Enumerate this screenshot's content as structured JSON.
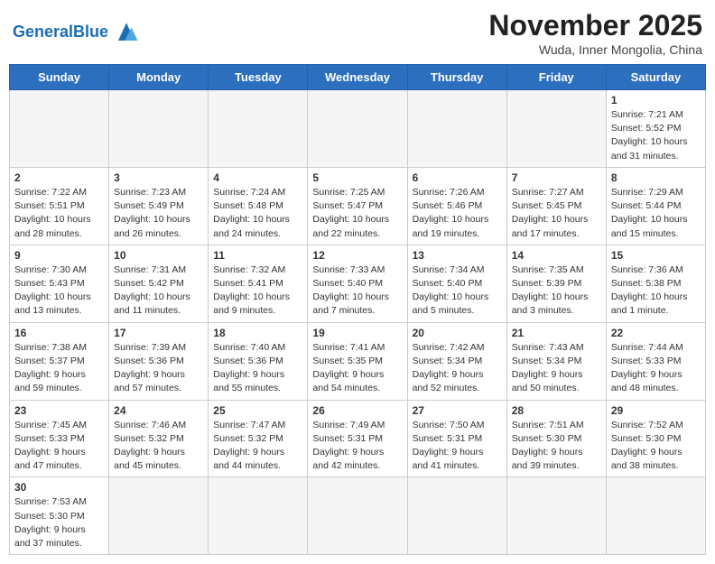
{
  "header": {
    "logo_general": "General",
    "logo_blue": "Blue",
    "month": "November 2025",
    "location": "Wuda, Inner Mongolia, China"
  },
  "weekdays": [
    "Sunday",
    "Monday",
    "Tuesday",
    "Wednesday",
    "Thursday",
    "Friday",
    "Saturday"
  ],
  "days": {
    "d1": {
      "num": "1",
      "sunrise": "Sunrise: 7:21 AM",
      "sunset": "Sunset: 5:52 PM",
      "daylight": "Daylight: 10 hours and 31 minutes."
    },
    "d2": {
      "num": "2",
      "sunrise": "Sunrise: 7:22 AM",
      "sunset": "Sunset: 5:51 PM",
      "daylight": "Daylight: 10 hours and 28 minutes."
    },
    "d3": {
      "num": "3",
      "sunrise": "Sunrise: 7:23 AM",
      "sunset": "Sunset: 5:49 PM",
      "daylight": "Daylight: 10 hours and 26 minutes."
    },
    "d4": {
      "num": "4",
      "sunrise": "Sunrise: 7:24 AM",
      "sunset": "Sunset: 5:48 PM",
      "daylight": "Daylight: 10 hours and 24 minutes."
    },
    "d5": {
      "num": "5",
      "sunrise": "Sunrise: 7:25 AM",
      "sunset": "Sunset: 5:47 PM",
      "daylight": "Daylight: 10 hours and 22 minutes."
    },
    "d6": {
      "num": "6",
      "sunrise": "Sunrise: 7:26 AM",
      "sunset": "Sunset: 5:46 PM",
      "daylight": "Daylight: 10 hours and 19 minutes."
    },
    "d7": {
      "num": "7",
      "sunrise": "Sunrise: 7:27 AM",
      "sunset": "Sunset: 5:45 PM",
      "daylight": "Daylight: 10 hours and 17 minutes."
    },
    "d8": {
      "num": "8",
      "sunrise": "Sunrise: 7:29 AM",
      "sunset": "Sunset: 5:44 PM",
      "daylight": "Daylight: 10 hours and 15 minutes."
    },
    "d9": {
      "num": "9",
      "sunrise": "Sunrise: 7:30 AM",
      "sunset": "Sunset: 5:43 PM",
      "daylight": "Daylight: 10 hours and 13 minutes."
    },
    "d10": {
      "num": "10",
      "sunrise": "Sunrise: 7:31 AM",
      "sunset": "Sunset: 5:42 PM",
      "daylight": "Daylight: 10 hours and 11 minutes."
    },
    "d11": {
      "num": "11",
      "sunrise": "Sunrise: 7:32 AM",
      "sunset": "Sunset: 5:41 PM",
      "daylight": "Daylight: 10 hours and 9 minutes."
    },
    "d12": {
      "num": "12",
      "sunrise": "Sunrise: 7:33 AM",
      "sunset": "Sunset: 5:40 PM",
      "daylight": "Daylight: 10 hours and 7 minutes."
    },
    "d13": {
      "num": "13",
      "sunrise": "Sunrise: 7:34 AM",
      "sunset": "Sunset: 5:40 PM",
      "daylight": "Daylight: 10 hours and 5 minutes."
    },
    "d14": {
      "num": "14",
      "sunrise": "Sunrise: 7:35 AM",
      "sunset": "Sunset: 5:39 PM",
      "daylight": "Daylight: 10 hours and 3 minutes."
    },
    "d15": {
      "num": "15",
      "sunrise": "Sunrise: 7:36 AM",
      "sunset": "Sunset: 5:38 PM",
      "daylight": "Daylight: 10 hours and 1 minute."
    },
    "d16": {
      "num": "16",
      "sunrise": "Sunrise: 7:38 AM",
      "sunset": "Sunset: 5:37 PM",
      "daylight": "Daylight: 9 hours and 59 minutes."
    },
    "d17": {
      "num": "17",
      "sunrise": "Sunrise: 7:39 AM",
      "sunset": "Sunset: 5:36 PM",
      "daylight": "Daylight: 9 hours and 57 minutes."
    },
    "d18": {
      "num": "18",
      "sunrise": "Sunrise: 7:40 AM",
      "sunset": "Sunset: 5:36 PM",
      "daylight": "Daylight: 9 hours and 55 minutes."
    },
    "d19": {
      "num": "19",
      "sunrise": "Sunrise: 7:41 AM",
      "sunset": "Sunset: 5:35 PM",
      "daylight": "Daylight: 9 hours and 54 minutes."
    },
    "d20": {
      "num": "20",
      "sunrise": "Sunrise: 7:42 AM",
      "sunset": "Sunset: 5:34 PM",
      "daylight": "Daylight: 9 hours and 52 minutes."
    },
    "d21": {
      "num": "21",
      "sunrise": "Sunrise: 7:43 AM",
      "sunset": "Sunset: 5:34 PM",
      "daylight": "Daylight: 9 hours and 50 minutes."
    },
    "d22": {
      "num": "22",
      "sunrise": "Sunrise: 7:44 AM",
      "sunset": "Sunset: 5:33 PM",
      "daylight": "Daylight: 9 hours and 48 minutes."
    },
    "d23": {
      "num": "23",
      "sunrise": "Sunrise: 7:45 AM",
      "sunset": "Sunset: 5:33 PM",
      "daylight": "Daylight: 9 hours and 47 minutes."
    },
    "d24": {
      "num": "24",
      "sunrise": "Sunrise: 7:46 AM",
      "sunset": "Sunset: 5:32 PM",
      "daylight": "Daylight: 9 hours and 45 minutes."
    },
    "d25": {
      "num": "25",
      "sunrise": "Sunrise: 7:47 AM",
      "sunset": "Sunset: 5:32 PM",
      "daylight": "Daylight: 9 hours and 44 minutes."
    },
    "d26": {
      "num": "26",
      "sunrise": "Sunrise: 7:49 AM",
      "sunset": "Sunset: 5:31 PM",
      "daylight": "Daylight: 9 hours and 42 minutes."
    },
    "d27": {
      "num": "27",
      "sunrise": "Sunrise: 7:50 AM",
      "sunset": "Sunset: 5:31 PM",
      "daylight": "Daylight: 9 hours and 41 minutes."
    },
    "d28": {
      "num": "28",
      "sunrise": "Sunrise: 7:51 AM",
      "sunset": "Sunset: 5:30 PM",
      "daylight": "Daylight: 9 hours and 39 minutes."
    },
    "d29": {
      "num": "29",
      "sunrise": "Sunrise: 7:52 AM",
      "sunset": "Sunset: 5:30 PM",
      "daylight": "Daylight: 9 hours and 38 minutes."
    },
    "d30": {
      "num": "30",
      "sunrise": "Sunrise: 7:53 AM",
      "sunset": "Sunset: 5:30 PM",
      "daylight": "Daylight: 9 hours and 37 minutes."
    }
  }
}
